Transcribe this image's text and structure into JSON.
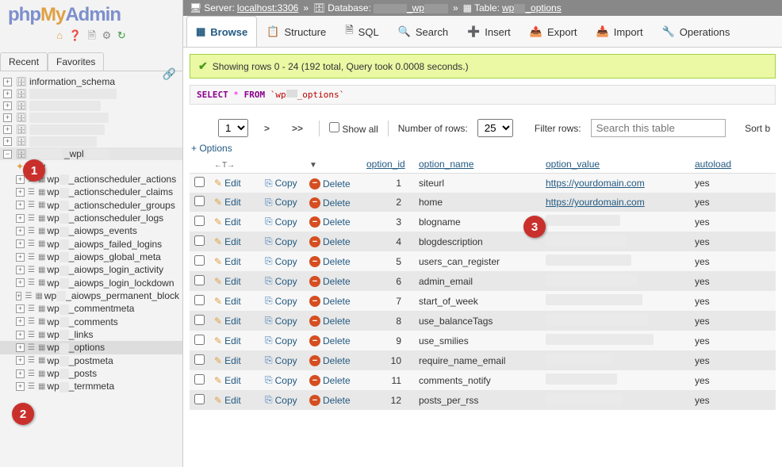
{
  "logo": {
    "php": "php",
    "my": "My",
    "admin": "Admin"
  },
  "nav_tabs": [
    "Recent",
    "Favorites"
  ],
  "tree": {
    "dbs": [
      "information_schema"
    ],
    "selected_db_suffix": "_wpl",
    "new_label": "New",
    "tables": [
      "wp_actionscheduler_actions",
      "wp_actionscheduler_claims",
      "wp_actionscheduler_groups",
      "wp_actionscheduler_logs",
      "wp_aiowps_events",
      "wp_aiowps_failed_logins",
      "wp_aiowps_global_meta",
      "wp_aiowps_login_activity",
      "wp_aiowps_login_lockdown",
      "wp_aiowps_permanent_block",
      "wp_commentmeta",
      "wp_comments",
      "wp_links",
      "wp_options",
      "wp_postmeta",
      "wp_posts",
      "wp_termmeta"
    ],
    "selected_table_index": 13
  },
  "breadcrumb": {
    "server_label": "Server:",
    "server": "localhost:3306",
    "db_label": "Database:",
    "db_suffix": "_wp",
    "table_label": "Table:",
    "table": "wp_options"
  },
  "menu": [
    {
      "label": "Browse",
      "active": true
    },
    {
      "label": "Structure"
    },
    {
      "label": "SQL"
    },
    {
      "label": "Search"
    },
    {
      "label": "Insert"
    },
    {
      "label": "Export"
    },
    {
      "label": "Import"
    },
    {
      "label": "Operations"
    }
  ],
  "success_msg": "Showing rows 0 - 24 (192 total, Query took 0.0008 seconds.)",
  "sql": {
    "select": "SELECT",
    "star": "*",
    "from": "FROM",
    "table": "`wp_options`"
  },
  "pager": {
    "page": "1",
    "next": ">",
    "last": ">>",
    "show_all": "Show all",
    "rows_label": "Number of rows:",
    "rows": "25",
    "filter_label": "Filter rows:",
    "filter_placeholder": "Search this table",
    "sort_label": "Sort b"
  },
  "options_link": "+ Options",
  "columns": [
    "option_id",
    "option_name",
    "option_value",
    "autoload"
  ],
  "actions": {
    "edit": "Edit",
    "copy": "Copy",
    "delete": "Delete"
  },
  "rows": [
    {
      "id": 1,
      "name": "siteurl",
      "value": "https://yourdomain.com",
      "value_link": true,
      "autoload": "yes"
    },
    {
      "id": 2,
      "name": "home",
      "value": "https://yourdomain.com",
      "value_link": true,
      "autoload": "yes"
    },
    {
      "id": 3,
      "name": "blogname",
      "value": "",
      "masked": true,
      "autoload": "yes"
    },
    {
      "id": 4,
      "name": "blogdescription",
      "value": "",
      "masked": true,
      "autoload": "yes"
    },
    {
      "id": 5,
      "name": "users_can_register",
      "value": "",
      "masked": true,
      "autoload": "yes"
    },
    {
      "id": 6,
      "name": "admin_email",
      "value": "",
      "masked": true,
      "autoload": "yes"
    },
    {
      "id": 7,
      "name": "start_of_week",
      "value": "",
      "masked": true,
      "autoload": "yes"
    },
    {
      "id": 8,
      "name": "use_balanceTags",
      "value": "",
      "masked": true,
      "autoload": "yes"
    },
    {
      "id": 9,
      "name": "use_smilies",
      "value": "",
      "masked": true,
      "autoload": "yes"
    },
    {
      "id": 10,
      "name": "require_name_email",
      "value": "",
      "masked": true,
      "autoload": "yes"
    },
    {
      "id": 11,
      "name": "comments_notify",
      "value": "",
      "masked": true,
      "autoload": "yes"
    },
    {
      "id": 12,
      "name": "posts_per_rss",
      "value": "",
      "masked": true,
      "autoload": "yes"
    }
  ],
  "badges": {
    "b1": "1",
    "b2": "2",
    "b3": "3"
  }
}
